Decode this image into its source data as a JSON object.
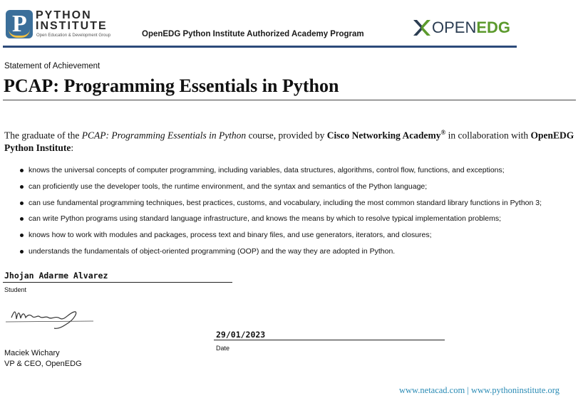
{
  "header": {
    "python_institute_line1": "PYTHON",
    "python_institute_line2": "INSTITUTE",
    "python_institute_sub": "Open Education & Development Group",
    "program": "OpenEDG Python Institute Authorized Academy Program",
    "openedg_part1": "OPEN",
    "openedg_part2": "EDG",
    "accent_blue": "#2c4a7a",
    "accent_green": "#5c9a2d"
  },
  "statement_label": "Statement of Achievement",
  "course_title": "PCAP: Programming Essentials in Python",
  "intro": {
    "part1": "The graduate of the ",
    "course_italic": "PCAP: Programming Essentials in Python",
    "part2": " course, provided by ",
    "provider": "Cisco Networking Academy",
    "reg": "®",
    "part3": " in collaboration with ",
    "institute": "OpenEDG Python Institute",
    "part4": ":"
  },
  "bullets": [
    "knows the universal concepts of computer programming, including variables, data structures, algorithms, control flow, functions, and exceptions;",
    "can proficiently use the developer tools, the runtime environment, and the syntax and semantics of the Python language;",
    "can use fundamental programming techniques, best practices, customs, and vocabulary, including the most common standard library functions in Python 3;",
    "can write Python programs using standard language infrastructure, and knows the means by which to resolve typical implementation problems;",
    "knows how to work with modules and packages, process text and binary files, and use generators, iterators, and closures;",
    "understands the fundamentals of object-oriented programming (OOP) and the way they are adopted in Python."
  ],
  "student": {
    "name": "Jhojan Adarme Alvarez",
    "label": "Student"
  },
  "signer": {
    "name": "Maciek Wichary",
    "title": "VP & CEO, OpenEDG"
  },
  "date": {
    "value": "29/01/2023",
    "label": "Date"
  },
  "footer": {
    "link1": "www.netacad.com",
    "separator": " | ",
    "link2": "www.pythoninstitute.org",
    "color": "#2a8bb5"
  }
}
